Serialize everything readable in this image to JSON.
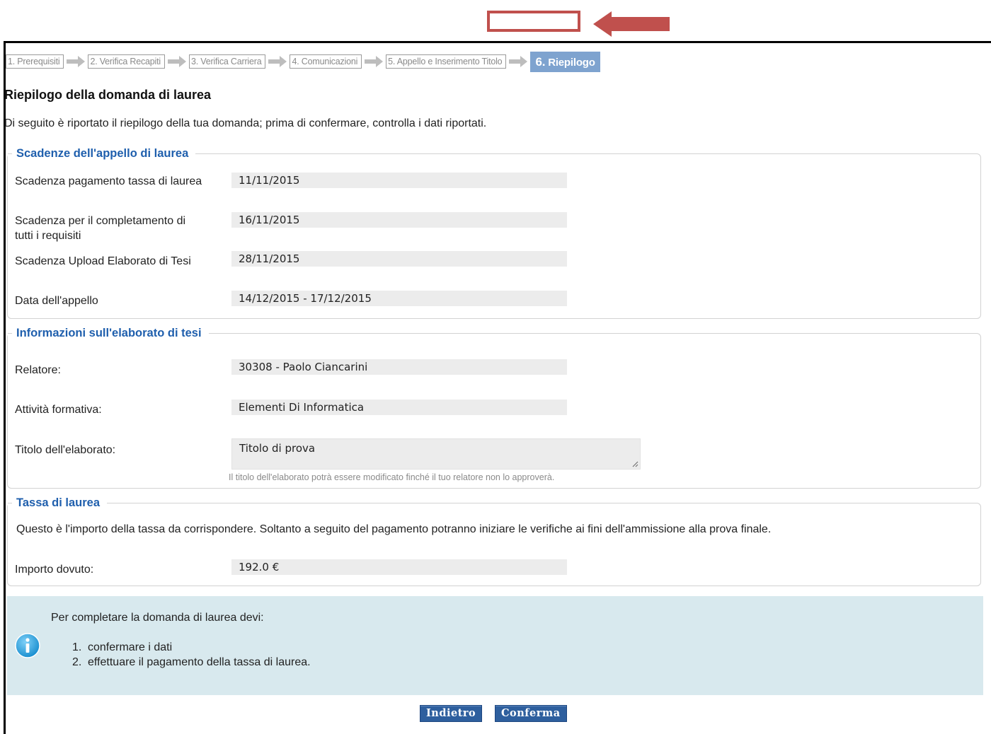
{
  "steps": [
    {
      "label": "1. Prerequisiti"
    },
    {
      "label": "2. Verifica Recapiti"
    },
    {
      "label": "3. Verifica Carriera"
    },
    {
      "label": "4. Comunicazioni"
    },
    {
      "label": "5. Appello e Inserimento Titolo"
    },
    {
      "num": "6.",
      "label": "Riepilogo",
      "active": true
    }
  ],
  "page": {
    "title": "Riepilogo della domanda di laurea",
    "intro": "Di seguito è riportato il riepilogo della tua domanda; prima di confermare, controlla i dati riportati."
  },
  "deadlines": {
    "legend": "Scadenze dell'appello di laurea",
    "rows": [
      {
        "label": "Scadenza pagamento tassa di laurea",
        "value": "11/11/2015"
      },
      {
        "label": "Scadenza per il completamento di tutti i requisiti",
        "value": "16/11/2015"
      },
      {
        "label": "Scadenza Upload Elaborato di Tesi",
        "value": "28/11/2015"
      },
      {
        "label": "Data dell'appello",
        "value": "14/12/2015 - 17/12/2015"
      }
    ]
  },
  "thesis": {
    "legend": "Informazioni sull'elaborato di tesi",
    "supervisor_label": "Relatore:",
    "supervisor_value": "30308 - Paolo Ciancarini",
    "activity_label": "Attività formativa:",
    "activity_value": "Elementi Di Informatica",
    "title_label": "Titolo dell'elaborato:",
    "title_value": "Titolo di prova",
    "title_hint": "Il titolo dell'elaborato potrà essere modificato finché il tuo relatore non lo approverà."
  },
  "fee": {
    "legend": "Tassa di laurea",
    "text": "Questo è l'importo della tassa da corrispondere. Soltanto a seguito del pagamento potranno iniziare le verifiche ai fini dell'ammissione alla prova finale.",
    "amount_label": "Importo dovuto:",
    "amount_value": "192.0 €"
  },
  "info": {
    "heading": "Per completare la domanda di laurea devi:",
    "items": [
      {
        "n": "1.",
        "text": "confermare i dati"
      },
      {
        "n": "2.",
        "text": "effettuare il pagamento della tassa di laurea."
      }
    ]
  },
  "buttons": {
    "back": "Indietro",
    "confirm": "Conferma"
  },
  "colors": {
    "annotation": "#c0504d",
    "legend_text": "#1f5fad",
    "active_step": "#7ea3cf",
    "info_panel": "#d8e9ee",
    "button": "#2e5f9e"
  },
  "icons": {
    "step_separator": "arrow-right-icon",
    "info": "info-icon",
    "annotation": "arrow-left-icon"
  }
}
